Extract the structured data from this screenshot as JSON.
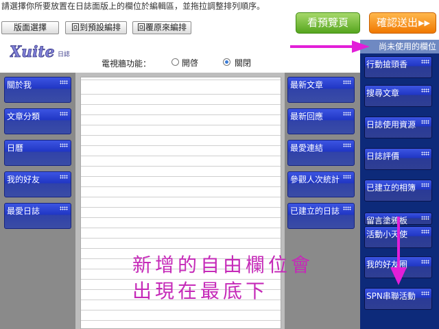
{
  "instruction": "請選擇你所要放置在日誌面版上的欄位於編輯區，並拖拉調整排列順序。",
  "toolbar": {
    "layout_select": "版面選擇",
    "reset_default": "回到預設編排",
    "restore_original": "回覆原來編排",
    "preview": "看預覽頁",
    "confirm": "確認送出",
    "confirm_arrow": "▶▶"
  },
  "editor": {
    "logo_text": "Xuite",
    "logo_sub": "日誌",
    "tv_wall_label": "電視牆功能：",
    "option_on": "開啓",
    "option_off": "關閉",
    "selected_option": "關閉",
    "left_column": [
      "關於我",
      "文章分類",
      "日曆",
      "我的好友",
      "最愛日誌"
    ],
    "right_column": [
      "最新文章",
      "最新回應",
      "最愛連結",
      "參觀人次統計",
      "已建立的日誌"
    ]
  },
  "unused_panel": {
    "title": "尚未使用的欄位",
    "items": [
      "行動搶頭香",
      "搜尋文章",
      "日誌使用資源",
      "日誌評價",
      "已建立的相簿",
      "留言塗鴉板",
      "活動小天使",
      "我的好友圈",
      "SPN串聯活動"
    ]
  },
  "annotation": {
    "line1": "新增的自由欄位會",
    "line2": "出現在最底下"
  },
  "colors": {
    "block_blue": "#2036c4",
    "panel_navy": "#0d2a7a",
    "preview_green": "#56a51e",
    "confirm_orange": "#f07800",
    "annotation_magenta": "#c52ab8"
  }
}
